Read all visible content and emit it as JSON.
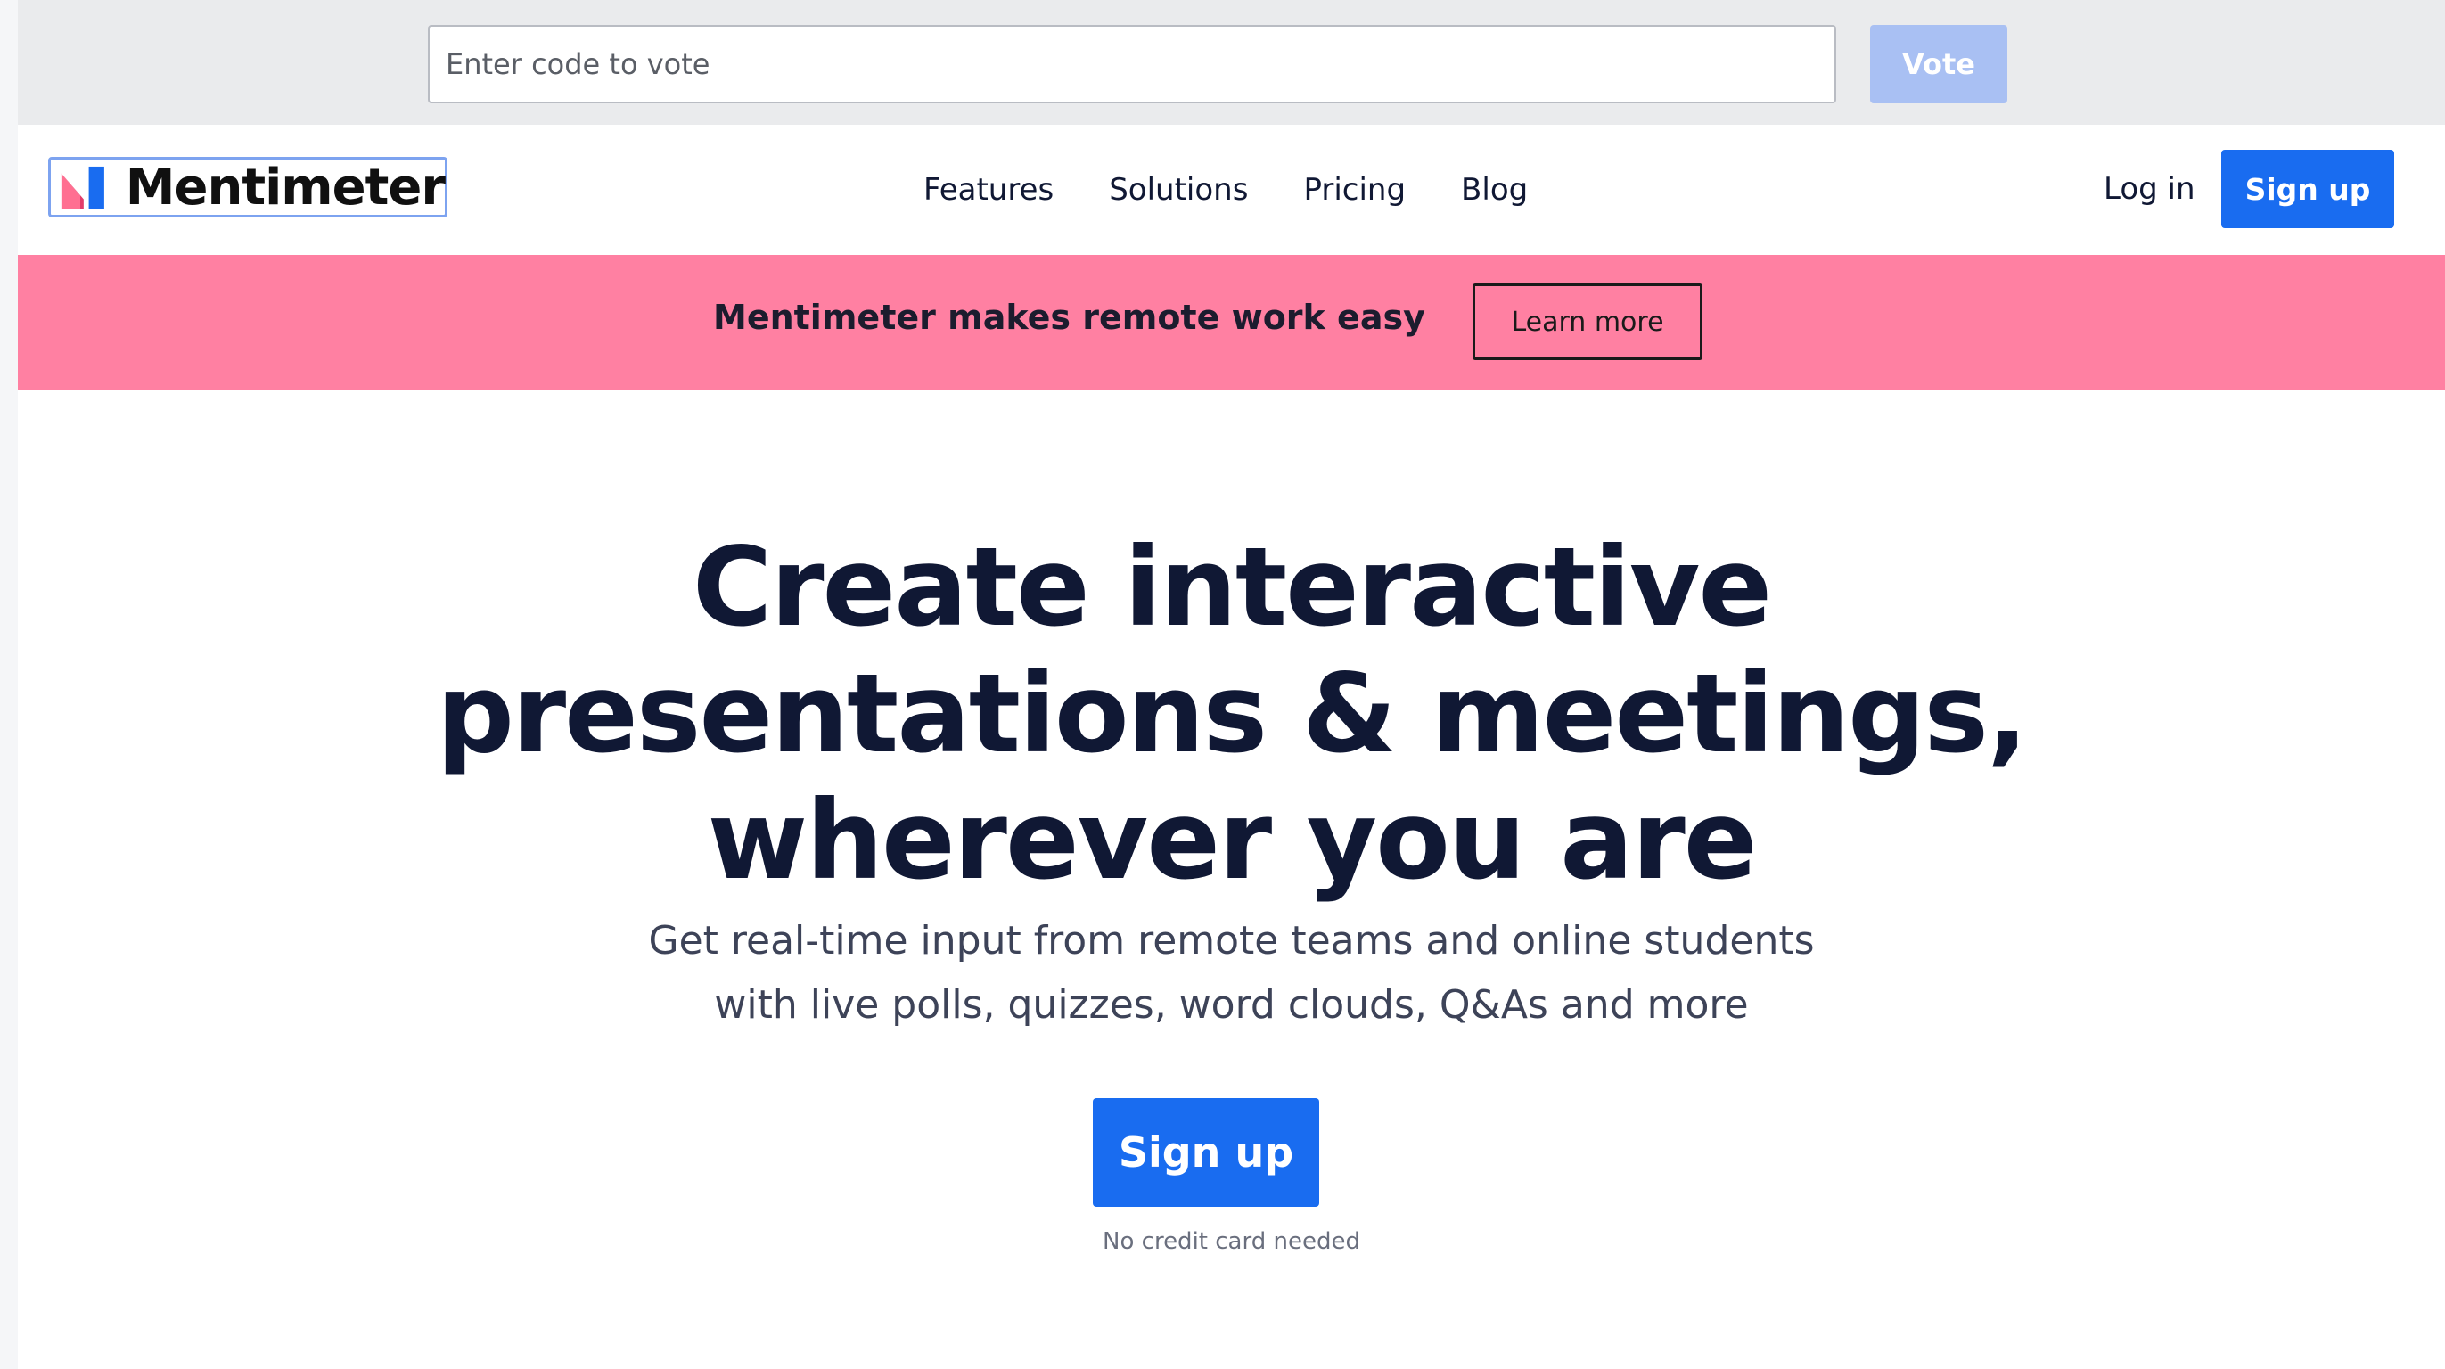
{
  "vote_bar": {
    "placeholder": "Enter code to vote",
    "button_label": "Vote"
  },
  "nav": {
    "logo_text": "Mentimeter",
    "links": [
      {
        "label": "Features"
      },
      {
        "label": "Solutions"
      },
      {
        "label": "Pricing"
      },
      {
        "label": "Blog"
      }
    ],
    "login_label": "Log in",
    "signup_label": "Sign up"
  },
  "banner": {
    "text": "Mentimeter makes remote work easy",
    "button_label": "Learn more"
  },
  "hero": {
    "title_lines": [
      "Create interactive",
      "presentations & meetings,",
      "wherever you are"
    ],
    "subtitle_lines": [
      "Get real-time input from remote teams and online students",
      "with live polls, quizzes, word clouds, Q&As and more"
    ],
    "signup_label": "Sign up",
    "note": "No credit card needed"
  },
  "colors": {
    "brand_blue": "#196cf0",
    "banner_pink": "#ff80a2",
    "vote_button_disabled": "#a9c0f3",
    "text_dark": "#101834"
  },
  "icons": {
    "logo_mark": "mentimeter-logo-icon"
  }
}
